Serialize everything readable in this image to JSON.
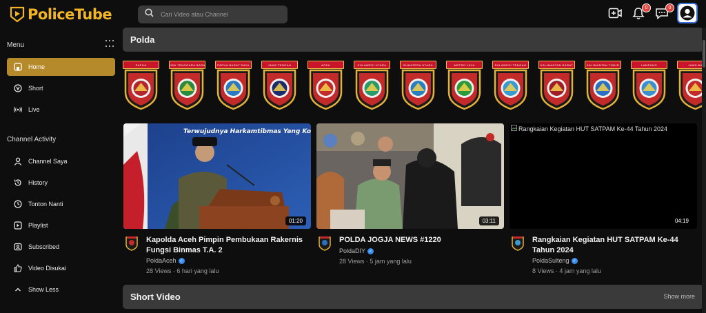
{
  "app": {
    "logo_text": "PoliceTube"
  },
  "search": {
    "placeholder": "Cari Video atau Channel"
  },
  "header": {
    "notification_count": "0",
    "message_count": "0"
  },
  "sidebar": {
    "menu_heading": "Menu",
    "menu_items": [
      {
        "label": "Home",
        "icon": "home-icon"
      },
      {
        "label": "Short",
        "icon": "short-icon"
      },
      {
        "label": "Live",
        "icon": "live-icon"
      }
    ],
    "activity_heading": "Channel Activity",
    "activity_items": [
      {
        "label": "Channel Saya",
        "icon": "user-icon"
      },
      {
        "label": "History",
        "icon": "history-icon"
      },
      {
        "label": "Tonton Nanti",
        "icon": "clock-icon"
      },
      {
        "label": "Playlist",
        "icon": "playlist-icon"
      },
      {
        "label": "Subscribed",
        "icon": "subscribed-icon"
      },
      {
        "label": "Video Disukai",
        "icon": "like-icon"
      },
      {
        "label": "Show Less",
        "icon": "chevron-up-icon"
      }
    ]
  },
  "polda_section": {
    "title": "Polda",
    "badges": [
      {
        "label": "PAPUA",
        "color": "#b3262e"
      },
      {
        "label": "NUSA TENGGARA BARAT",
        "color": "#2a8a3e"
      },
      {
        "label": "PAPUA BARAT DAYA",
        "color": "#2b79c2"
      },
      {
        "label": "JAWA TENGAH",
        "color": "#1d2a6b"
      },
      {
        "label": "ACEH",
        "color": "#c42a2a"
      },
      {
        "label": "SULAWESI UTARA",
        "color": "#2a9a6a"
      },
      {
        "label": "SUMATERA UTARA",
        "color": "#2a7fbf"
      },
      {
        "label": "METRO JAYA",
        "color": "#2b9a3a"
      },
      {
        "label": "SULAWESI TENGAH",
        "color": "#3a9ad0"
      },
      {
        "label": "KALIMANTAN BARAT",
        "color": "#a01f2a"
      },
      {
        "label": "KALIMANTAN TIMUR",
        "color": "#2a6fc2"
      },
      {
        "label": "LAMPUNG",
        "color": "#3a8fd0"
      },
      {
        "label": "JAWA BA",
        "color": "#c42a2a"
      }
    ]
  },
  "videos": [
    {
      "title": "Kapolda Aceh Pimpin Pembukaan Rakernis Fungsi Binmas T.A. 2",
      "channel": "PoldaAceh",
      "views": "28 Views",
      "age": "6 hari yang lalu",
      "duration": "01:20",
      "thumb_caption": "Terwujudnya Harkamtibmas Yang Kon"
    },
    {
      "title": "POLDA JOGJA NEWS #1220",
      "channel": "PoldaDIY",
      "views": "28 Views",
      "age": "5 jam yang lalu",
      "duration": "03:11"
    },
    {
      "title": "Rangkaian Kegiatan HUT SATPAM Ke-44 Tahun 2024",
      "channel": "PoldaSulteng",
      "views": "8 Views",
      "age": "4 jam yang lalu",
      "duration": "04:19",
      "alt_text": "Rangkaian Kegiatan HUT SATPAM Ke-44 Tahun 2024"
    }
  ],
  "short_section": {
    "title": "Short Video",
    "show_more": "Show more"
  },
  "colors": {
    "accent": "#b58a2a",
    "logo_gold": "#f3b523",
    "panel": "#3a3a3a",
    "background": "#0e0e0e"
  }
}
